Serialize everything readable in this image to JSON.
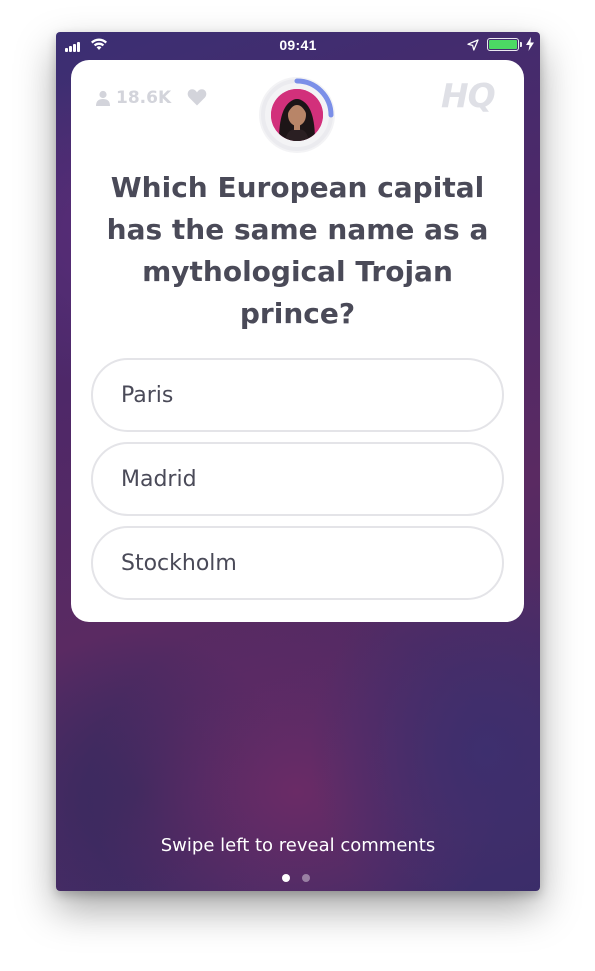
{
  "status_bar": {
    "time": "09:41",
    "battery_level": 1.0,
    "icons": [
      "signal-icon",
      "wifi-icon",
      "location-arrow-icon",
      "battery-icon",
      "charging-icon"
    ]
  },
  "header": {
    "viewer_count": "18.6K",
    "logo": "HQ",
    "icons": [
      "person-icon",
      "heart-icon"
    ]
  },
  "timer": {
    "remaining_fraction": 0.25
  },
  "question": {
    "text": "Which European capital has the same name as a mythological Trojan prince?"
  },
  "answers": [
    {
      "label": "Paris"
    },
    {
      "label": "Madrid"
    },
    {
      "label": "Stockholm"
    }
  ],
  "footer": {
    "swipe_hint": "Swipe left to reveal comments",
    "pages": 2,
    "active_page": 1
  },
  "colors": {
    "accent_timer": "#7b8fe8",
    "text": "#4a4a58",
    "muted": "#d3d4db",
    "battery": "#4cd964"
  }
}
